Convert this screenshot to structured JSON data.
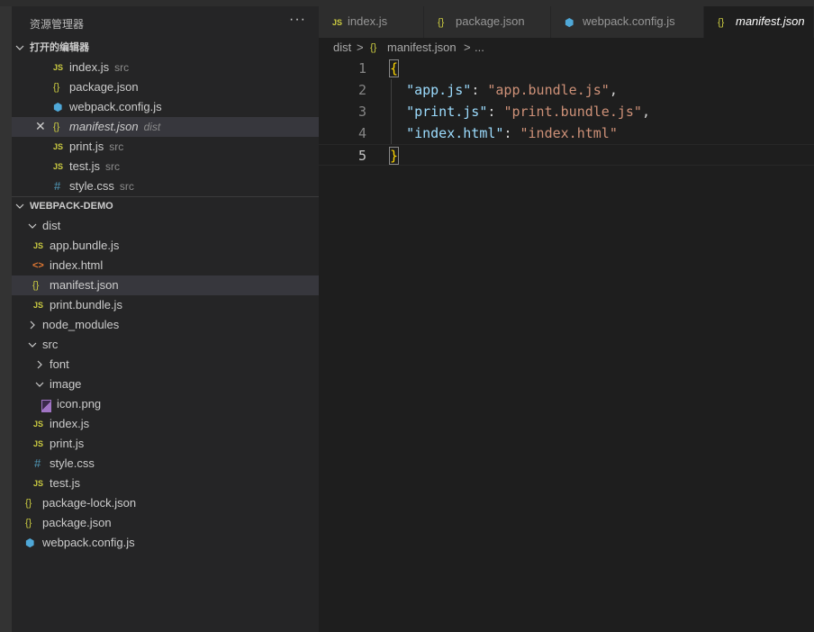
{
  "sidebar": {
    "title": "资源管理器",
    "more": "···",
    "open_editors": {
      "label": "打开的编辑器",
      "items": [
        {
          "icon": "JS",
          "name": "index.js",
          "desc": "src"
        },
        {
          "icon": "{}",
          "name": "package.json",
          "desc": ""
        },
        {
          "icon": "⬢",
          "name": "webpack.config.js",
          "desc": ""
        },
        {
          "icon": "{}",
          "name": "manifest.json",
          "desc": "dist",
          "close": "✕"
        },
        {
          "icon": "JS",
          "name": "print.js",
          "desc": "src"
        },
        {
          "icon": "JS",
          "name": "test.js",
          "desc": "src"
        },
        {
          "icon": "#",
          "name": "style.css",
          "desc": "src"
        }
      ]
    },
    "project": {
      "label": "WEBPACK-DEMO",
      "tree": [
        {
          "name": "dist"
        },
        {
          "icon": "JS",
          "name": "app.bundle.js"
        },
        {
          "icon": "<>",
          "name": "index.html"
        },
        {
          "icon": "{}",
          "name": "manifest.json"
        },
        {
          "icon": "JS",
          "name": "print.bundle.js"
        },
        {
          "name": "node_modules"
        },
        {
          "name": "src"
        },
        {
          "name": "font"
        },
        {
          "name": "image"
        },
        {
          "name": "icon.png"
        },
        {
          "icon": "JS",
          "name": "index.js"
        },
        {
          "icon": "JS",
          "name": "print.js"
        },
        {
          "icon": "#",
          "name": "style.css"
        },
        {
          "icon": "JS",
          "name": "test.js"
        },
        {
          "icon": "{}",
          "name": "package-lock.json"
        },
        {
          "icon": "{}",
          "name": "package.json"
        },
        {
          "icon": "⬢",
          "name": "webpack.config.js"
        }
      ]
    }
  },
  "tabs": [
    {
      "icon": "JS",
      "label": "index.js"
    },
    {
      "icon": "{}",
      "label": "package.json"
    },
    {
      "icon": "⬢",
      "label": "webpack.config.js"
    },
    {
      "icon": "{}",
      "label": "manifest.json",
      "active": true
    }
  ],
  "breadcrumb": {
    "folder": "dist",
    "sep": ">",
    "icon": "{}",
    "file": "manifest.json",
    "more": "..."
  },
  "editor": {
    "lines": [
      {
        "num": "1",
        "open": "{"
      },
      {
        "num": "2",
        "key": "\"app.js\"",
        "colon": ": ",
        "value": "\"app.bundle.js\"",
        "comma": ","
      },
      {
        "num": "3",
        "key": "\"print.js\"",
        "colon": ": ",
        "value": "\"print.bundle.js\"",
        "comma": ","
      },
      {
        "num": "4",
        "key": "\"index.html\"",
        "colon": ": ",
        "value": "\"index.html\"",
        "comma": ""
      },
      {
        "num": "5",
        "close": "}"
      }
    ]
  }
}
